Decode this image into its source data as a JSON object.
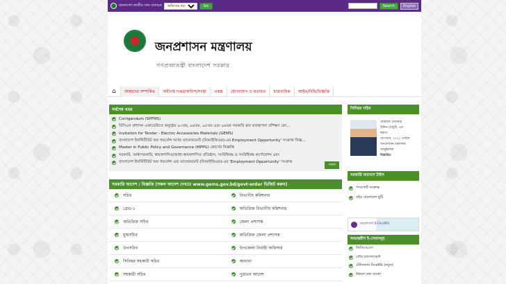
{
  "topbar": {
    "portal_label": "বাংলাদেশ জাতীয় তথ্য বাতায়ন",
    "office_select": "অফিসের ধরণ",
    "go_label": "Go",
    "search_label": "Search",
    "english_label": "English"
  },
  "header": {
    "ministry_name": "জনপ্রশাসন মন্ত্রণালয়",
    "govt_name": "গণপ্রজাতন্ত্রী বাংলাদেশ সরকার"
  },
  "nav": {
    "items": [
      "আমাদের সম্পর্কিত",
      "অধীনস্থ দপ্তর/অফিস/সংস্থা",
      "প্রকল্প",
      "যোগাযোগ ও মতামত",
      "ধারাবাহিক",
      "আইন/বিধি/বিজ্ঞপ্তি"
    ]
  },
  "news": {
    "heading": "সর্বশেষ খবর",
    "items": [
      "Corrigendum (SPFMS)",
      "বিসিএস প্রশাসন একাডেমিতে অনুষ্ঠেয় ৯৩তম, ৯৪তম, ৯৫তম এবং ৯৬তম সরকারি ক্রয় ব্যবস্থাপনা প্রশিক্ষণ কো...",
      "Invitation for Tender - Electric Accessories Materials (GEMS)",
      "বাংলাদেশ ইনস্টিটিউট অব গভর্নেন্স অ্যান্ড ম্যানেজমেন্ট (বিআইজিএম)-এর Employment Opportunity' সংক্রান্ত বিজ্ঞ...",
      "Master in Public Policy and Governance (MPPG) কোর্সের বিজ্ঞপ্তি",
      "সরকারি, আধাসরকারি, স্বায়ত্তশাসিত/আধা-স্বায়ত্তশাসিত প্রতিষ্ঠান, সংবিধিবদ্ধ ও সংবিধিবদ্ধ কর্পোরেশন এবং",
      "বাংলাদেশ ইনস্টিটিউট অব গভর্নেন্স এন্ড ম্যানেজমেন্ট (বিআইজিএম)-এর 'Employment Opportunity' সংক্রান্ত"
    ],
    "all_label": "সকল"
  },
  "orders": {
    "heading": "সরকারি আদেশ / বিজ্ঞপ্তি (সকল আদেশ দেখতে www.gems.gov.bd/govt-order ভিজিট করুন)",
    "left": [
      "সচিব",
      "গ্রেড-১",
      "অতিরিক্ত সচিব",
      "যুগ্মসচিব",
      "উপসচিব",
      "সিনিয়র সহকারী সচিব",
      "সহকারী সচিব"
    ],
    "right": [
      "বিভাগীয় কমিশনার",
      "অতিরিক্ত বিভাগীয় কমিশনার",
      "জেলা প্রশাসক",
      "অতিরিক্ত জেলা প্রশাসক",
      "উপজেলা নির্বাহী অফিসার",
      "অন্যান্য",
      "পুরাতন আদেশ"
    ]
  },
  "secretary": {
    "heading": "সিনিয়র সচিব",
    "name_lines": [
      "মোহাম্মদ মেজবাহ",
      "উদ্দিন চৌধুরী, এন",
      "দক্ষতা",
      "যোগদান: ২০২১ তারিখ",
      "জনপ্রশাসন মন্ত্রণালয়",
      "আনুষ্ঠানিক",
      "বিস্তারিত"
    ]
  },
  "notices": {
    "heading": "সরকারি আদেশে টাইপ",
    "items": [
      "পাসপোর্ট সংক্রান্ত",
      "বহিঃ বাংলাদেশ ছুটি"
    ]
  },
  "banner": {
    "text": "বাংলাদেশ ই-ডিরেক্টরি"
  },
  "eservices": {
    "heading": "অভ্যন্তরীণ ই-সেবাসমূহ",
    "items": [
      "জিডিএমএস",
      "তৌর ম্যানেজমেন্ট",
      "টেলিফোন ডিরেক্টরি (নতুন)",
      "উন্নয়ন তথ্য ব্যবস্থা"
    ]
  },
  "colors": {
    "topbar": "#5b2a86",
    "accent": "#4b8f2a",
    "nav_text": "#b00000"
  }
}
